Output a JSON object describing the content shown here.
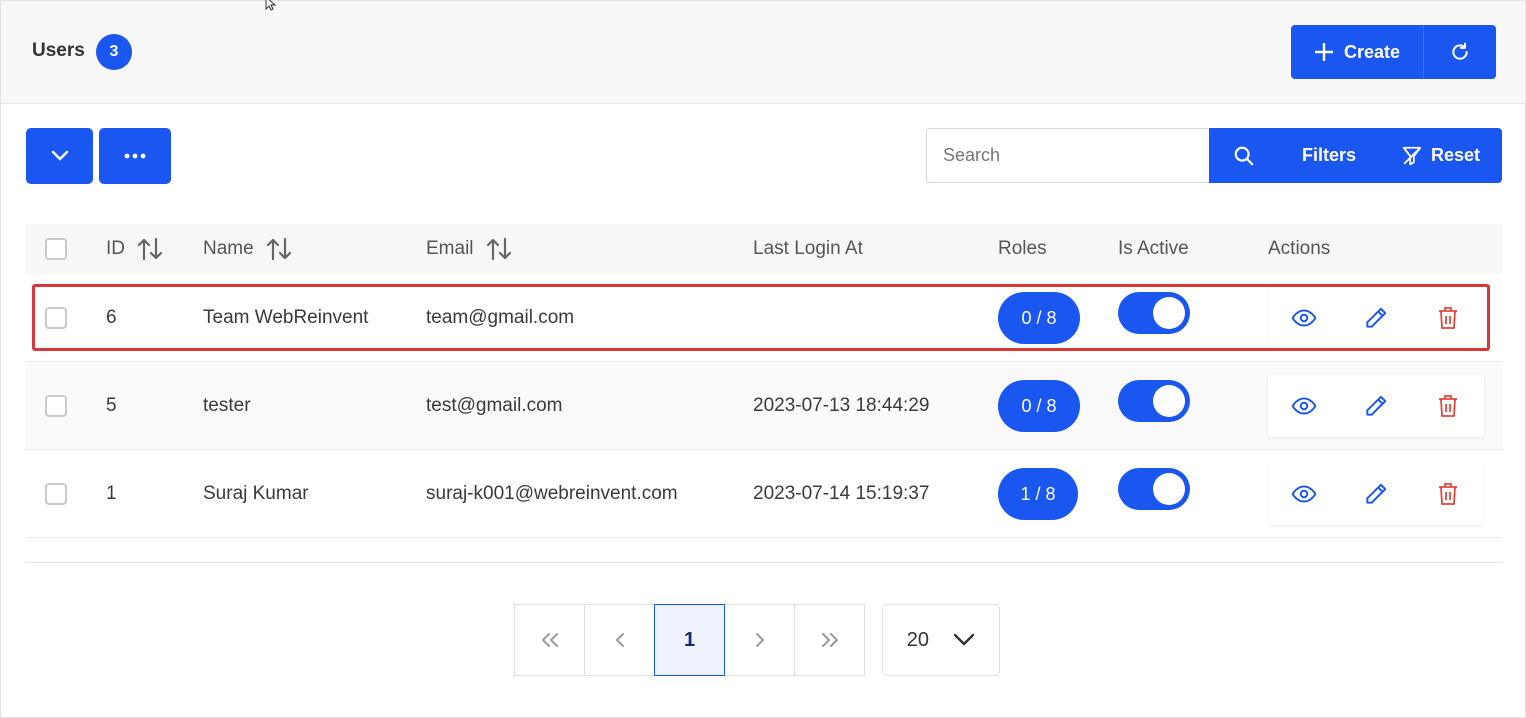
{
  "header": {
    "title": "Users",
    "count": "3",
    "create_label": "Create"
  },
  "toolbar": {
    "search_placeholder": "Search",
    "filters_label": "Filters",
    "reset_label": "Reset"
  },
  "table": {
    "columns": {
      "id": "ID",
      "name": "Name",
      "email": "Email",
      "last_login": "Last Login At",
      "roles": "Roles",
      "is_active": "Is Active",
      "actions": "Actions"
    },
    "rows": [
      {
        "id": "6",
        "name": "Team WebReinvent",
        "email": "team@gmail.com",
        "last_login": "",
        "roles": "0 / 8",
        "active": true
      },
      {
        "id": "5",
        "name": "tester",
        "email": "test@gmail.com",
        "last_login": "2023-07-13 18:44:29",
        "roles": "0 / 8",
        "active": true
      },
      {
        "id": "1",
        "name": "Suraj Kumar",
        "email": "suraj-k001@webreinvent.com",
        "last_login": "2023-07-14 15:19:37",
        "roles": "1 / 8",
        "active": true
      }
    ]
  },
  "pagination": {
    "current_page": "1",
    "per_page": "20"
  },
  "colors": {
    "primary": "#1a56f0",
    "danger": "#e0473a",
    "highlight": "#d9373a"
  }
}
